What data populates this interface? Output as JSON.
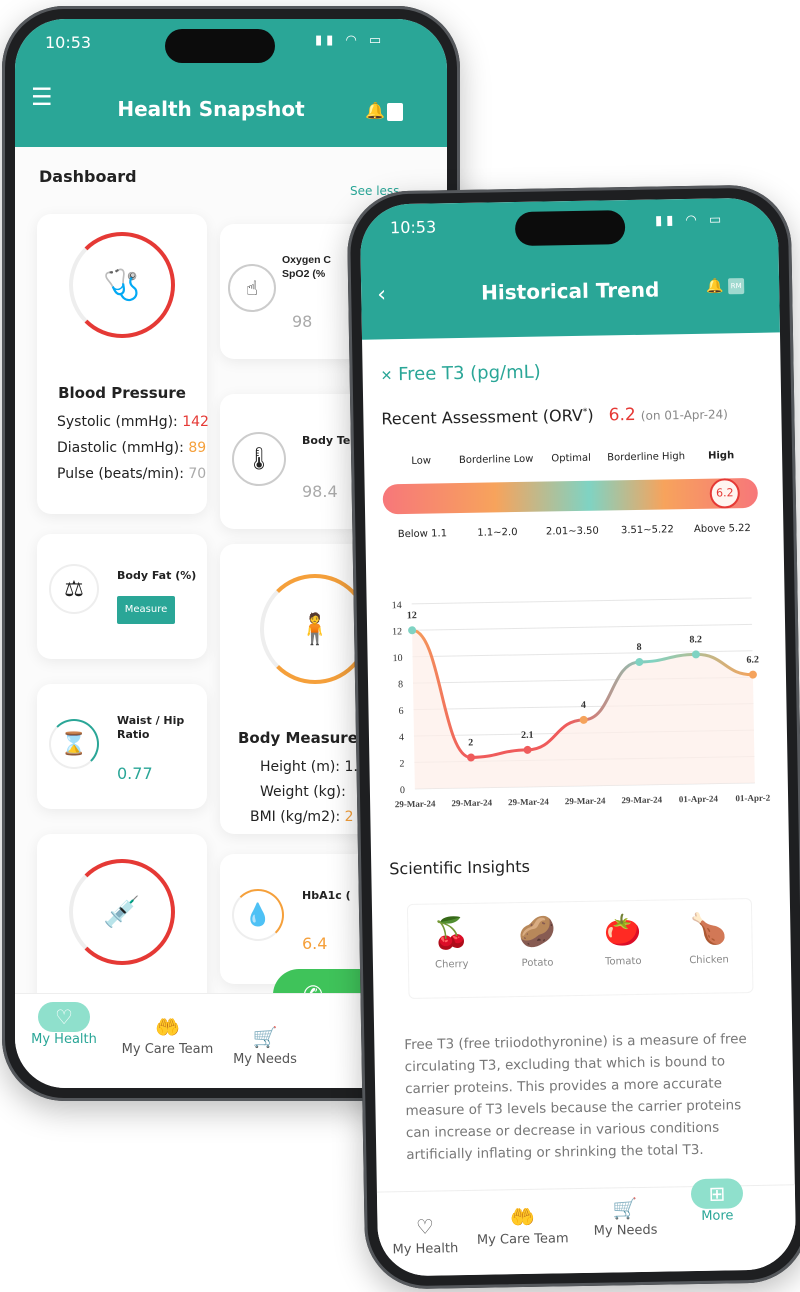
{
  "left_phone": {
    "status_time": "10:53",
    "header_title": "Health Snapshot",
    "section_title": "Dashboard",
    "see_less": "See less",
    "blood_pressure": {
      "title": "Blood Pressure",
      "lines": [
        {
          "label": "Systolic (mmHg): ",
          "value": "142",
          "color": "#e53935"
        },
        {
          "label": "Diastolic (mmHg): ",
          "value": "89",
          "color": "#f5a03b"
        },
        {
          "label": "Pulse (beats/min): ",
          "value": "70",
          "color": "#aaaaaa"
        }
      ]
    },
    "oxygen": {
      "title": "Oxygen C\nSpO2 (%",
      "value": "98"
    },
    "body_temp": {
      "title": "Body Te",
      "value": "98.4"
    },
    "body_fat": {
      "title": "Body Fat (%)",
      "button": "Measure"
    },
    "body_measure": {
      "title": "Body Measure",
      "lines": [
        {
          "label": "Height (m): ",
          "value": "1."
        },
        {
          "label": "Weight (kg): ",
          "value": ""
        },
        {
          "label": "BMI (kg/m2): ",
          "value": "2"
        }
      ]
    },
    "waist_hip": {
      "title": "Waist / Hip\nRatio",
      "value": "0.77"
    },
    "hba1c": {
      "title": "HbA1c (",
      "value": "6.4"
    },
    "nav": [
      {
        "label": "My Health",
        "icon": "heart-icon",
        "active": true
      },
      {
        "label": "My Care Team",
        "icon": "care-team-icon"
      },
      {
        "label": "My Needs",
        "icon": "cart-icon"
      }
    ]
  },
  "right_phone": {
    "status_time": "10:53",
    "header_title": "Historical Trend",
    "avatar_initials": "RM",
    "test_name": "Free T3 (pg/mL)",
    "assessment_label": "Recent Assessment (ORV",
    "assessment_sup": "*",
    "assessment_close": ")",
    "assessment_value": "6.2",
    "assessment_date": "(on 01-Apr-24)",
    "range_marker": "6.2",
    "ranges": [
      {
        "name": "Low",
        "range": "Below 1.1"
      },
      {
        "name": "Borderline Low",
        "range": "1.1~2.0"
      },
      {
        "name": "Optimal",
        "range": "2.01~3.50"
      },
      {
        "name": "Borderline High",
        "range": "3.51~5.22"
      },
      {
        "name": "High",
        "range": "Above 5.22",
        "active": true
      }
    ],
    "insights_title": "Scientific Insights",
    "foods": [
      {
        "name": "Cherry",
        "icon": "🍒"
      },
      {
        "name": "Potato",
        "icon": "🥔"
      },
      {
        "name": "Tomato",
        "icon": "🍅"
      },
      {
        "name": "Chicken",
        "icon": "🍗"
      }
    ],
    "description": "Free T3 (free triiodothyronine) is a measure of free circulating T3, excluding that which is bound to carrier proteins. This provides a more accurate measure of T3 levels because the carrier proteins can increase or decrease in various conditions artificially inflating or shrinking the total T3.",
    "nav": [
      {
        "label": "My Health",
        "icon": "heart-icon"
      },
      {
        "label": "My Care Team",
        "icon": "care-team-icon"
      },
      {
        "label": "My Needs",
        "icon": "cart-icon"
      },
      {
        "label": "More",
        "icon": "more-apps-icon",
        "active": true
      }
    ]
  },
  "chart_data": {
    "type": "line",
    "categories": [
      "29-Mar-24",
      "29-Mar-24",
      "29-Mar-24",
      "29-Mar-24",
      "29-Mar-24",
      "01-Apr-24",
      "01-Apr-24"
    ],
    "values": [
      12,
      2.3,
      2.8,
      5,
      9.3,
      9.8,
      8.2
    ],
    "data_labels": [
      "12",
      "2",
      "2.1",
      "4",
      "8",
      "8.2",
      "6.2"
    ],
    "ylim": [
      0,
      14
    ],
    "yticks": [
      0,
      2,
      4,
      6,
      8,
      10,
      12,
      14
    ],
    "grid": true,
    "colors": {
      "high": "#f5a35c",
      "low": "#ef5b5b",
      "optimal": "#7fd3c3"
    }
  },
  "colors": {
    "brand": "#2aa697",
    "alert": "#e53935",
    "warning": "#f5a03b"
  }
}
